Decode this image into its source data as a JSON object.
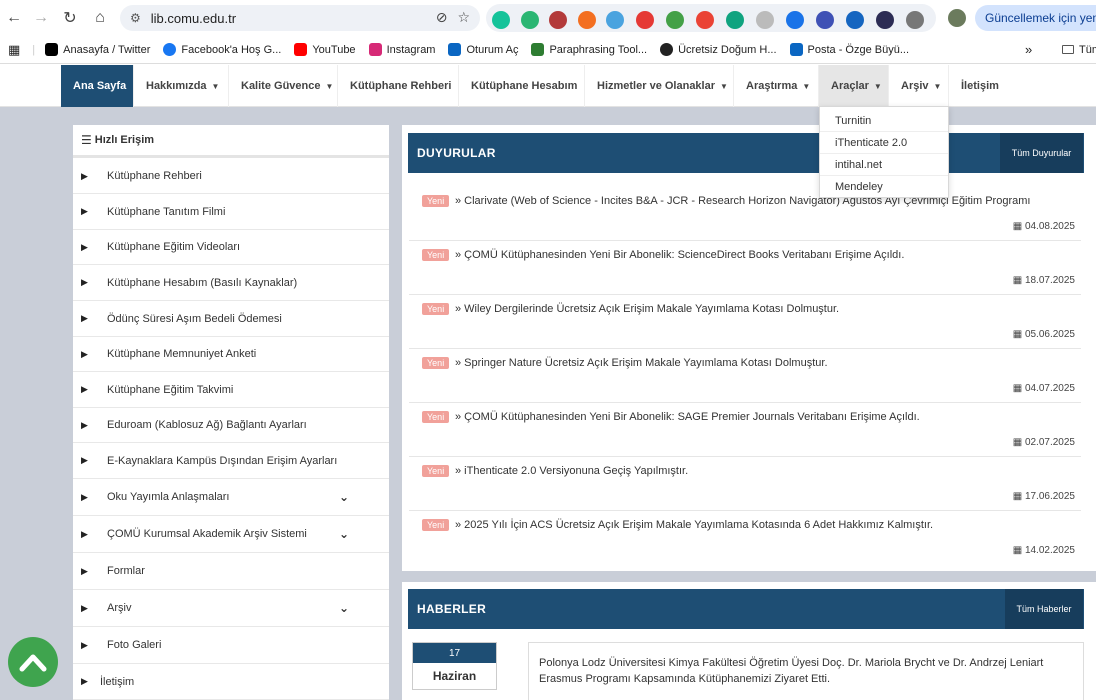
{
  "browser": {
    "url": "lib.comu.edu.tr",
    "update_label": "Güncellemek için yeniden",
    "bookmarks": [
      {
        "label": "Anasayfa / Twitter",
        "color": "#000000"
      },
      {
        "label": "Facebook'a Hoş G...",
        "color": "#1877f2"
      },
      {
        "label": "YouTube",
        "color": "#ff0000"
      },
      {
        "label": "Instagram",
        "color": "#d62976"
      },
      {
        "label": "Oturum Aç",
        "color": "#0a66c2"
      },
      {
        "label": "Paraphrasing Tool...",
        "color": "#2e7d32"
      },
      {
        "label": "Ücretsiz Doğum H...",
        "color": "#222222"
      },
      {
        "label": "Posta - Özge Büyü...",
        "color": "#0a66c2"
      }
    ],
    "bookmarks_more": "»",
    "bookmarks_folder": "Tüm"
  },
  "nav": {
    "items": [
      {
        "label": "Ana Sayfa",
        "caret": ""
      },
      {
        "label": "Hakkımızda",
        "caret": "▼"
      },
      {
        "label": "Kalite Güvence",
        "caret": "▼"
      },
      {
        "label": "Kütüphane Rehberi",
        "caret": ""
      },
      {
        "label": "Kütüphane Hesabım",
        "caret": ""
      },
      {
        "label": "Hizmetler ve Olanaklar",
        "caret": "▼"
      },
      {
        "label": "Araştırma",
        "caret": "▼"
      },
      {
        "label": "Araçlar",
        "caret": "▼"
      },
      {
        "label": "Arşiv",
        "caret": "▼"
      },
      {
        "label": "İletişim",
        "caret": ""
      }
    ],
    "dropdown": [
      "Turnitin",
      "iThenticate 2.0",
      "intihal.net",
      "Mendeley"
    ]
  },
  "sidebar": {
    "title": "Hızlı Erişim",
    "items": [
      {
        "label": "Kütüphane Rehberi",
        "chev": ""
      },
      {
        "label": "Kütüphane Tanıtım Filmi",
        "chev": ""
      },
      {
        "label": "Kütüphane Eğitim Videoları",
        "chev": ""
      },
      {
        "label": "Kütüphane Hesabım (Basılı Kaynaklar)",
        "chev": ""
      },
      {
        "label": "Ödünç Süresi Aşım Bedeli Ödemesi",
        "chev": ""
      },
      {
        "label": "Kütüphane Memnuniyet Anketi",
        "chev": ""
      },
      {
        "label": "Kütüphane Eğitim Takvimi",
        "chev": ""
      },
      {
        "label": "Eduroam (Kablosuz Ağ) Bağlantı Ayarları",
        "chev": ""
      },
      {
        "label": "E-Kaynaklara Kampüs Dışından Erişim Ayarları",
        "chev": ""
      },
      {
        "label": "Oku Yayımla Anlaşmaları",
        "chev": "⌄"
      },
      {
        "label": "ÇOMÜ Kurumsal Akademik Arşiv Sistemi",
        "chev": "⌄"
      },
      {
        "label": "Formlar",
        "chev": ""
      },
      {
        "label": "Arşiv",
        "chev": "⌄"
      },
      {
        "label": "Foto Galeri",
        "chev": ""
      },
      {
        "label": "İletişim",
        "chev": ""
      }
    ]
  },
  "announcements": {
    "title": "DUYURULAR",
    "all_label": "Tüm Duyurular",
    "badge": "Yeni",
    "items": [
      {
        "text": "» Clarivate (Web of Science - Incites B&A - JCR - Research Horizon Navigator) Ağustos Ayı Çevrimiçi Eğitim Programı",
        "date": "04.08.2025"
      },
      {
        "text": "» ÇOMÜ Kütüphanesinden Yeni Bir Abonelik: ScienceDirect Books Veritabanı Erişime Açıldı.",
        "date": "18.07.2025"
      },
      {
        "text": "» Wiley Dergilerinde Ücretsiz Açık Erişim Makale Yayımlama Kotası Dolmuştur.",
        "date": "05.06.2025"
      },
      {
        "text": "» Springer Nature Ücretsiz Açık Erişim Makale Yayımlama Kotası Dolmuştur.",
        "date": "04.07.2025"
      },
      {
        "text": "» ÇOMÜ Kütüphanesinden Yeni Bir Abonelik: SAGE Premier Journals Veritabanı Erişime Açıldı.",
        "date": "02.07.2025"
      },
      {
        "text": "» iThenticate 2.0 Versiyonuna Geçiş Yapılmıştır.",
        "date": "17.06.2025"
      },
      {
        "text": "» 2025 Yılı İçin ACS Ücretsiz Açık Erişim Makale Yayımlama Kotasında 6 Adet Hakkımız Kalmıştır.",
        "date": "14.02.2025"
      }
    ]
  },
  "news": {
    "title": "HABERLER",
    "all_label": "Tüm Haberler",
    "day": "17",
    "month": "Haziran",
    "text": "Polonya Lodz Üniversitesi Kimya Fakültesi Öğretim Üyesi Doç. Dr. Mariola Brycht ve Dr. Andrzej Leniart Erasmus Programı Kapsamında Kütüphanemizi Ziyaret Etti."
  }
}
